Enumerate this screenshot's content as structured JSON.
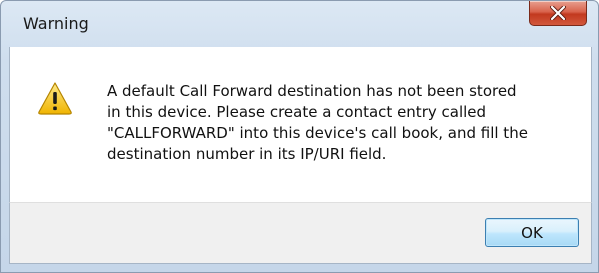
{
  "window": {
    "title": "Warning",
    "close_icon": "close-icon"
  },
  "dialog": {
    "icon": "warning-icon",
    "message_lines": [
      "A default Call Forward destination has not been stored",
      "in this device. Please create a contact entry called",
      "\"CALLFORWARD\" into this device's call book, and fill the",
      "destination number in its IP/URI field."
    ]
  },
  "buttons": {
    "ok_label": "OK"
  },
  "colors": {
    "close_button": "#c2391f",
    "ok_button_border": "#3c7fb1",
    "warning_icon_fill": "#f3c320"
  }
}
